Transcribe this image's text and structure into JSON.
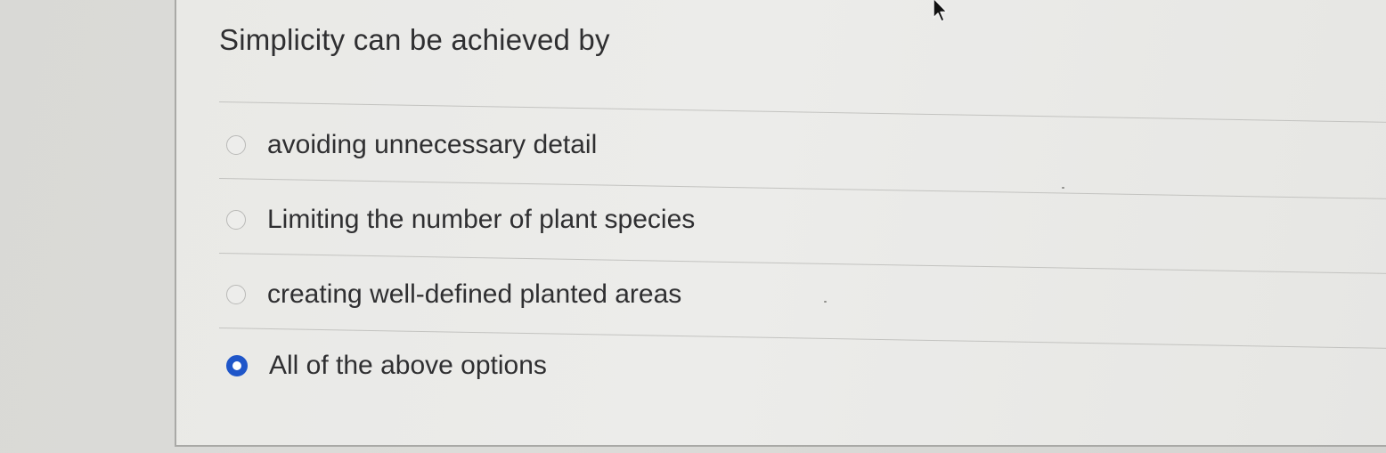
{
  "question": {
    "text": "Simplicity can be achieved by"
  },
  "options": [
    {
      "label": "avoiding unnecessary detail",
      "selected": false
    },
    {
      "label": "Limiting the number of plant species",
      "selected": false
    },
    {
      "label": "creating well-defined planted areas",
      "selected": false
    },
    {
      "label": "All of the above options",
      "selected": true
    }
  ],
  "colors": {
    "selected_radio": "#1f56c9",
    "text": "#2f2f31",
    "divider": "#c3c3c0"
  },
  "icons": {
    "cursor": "mouse-pointer-icon"
  }
}
